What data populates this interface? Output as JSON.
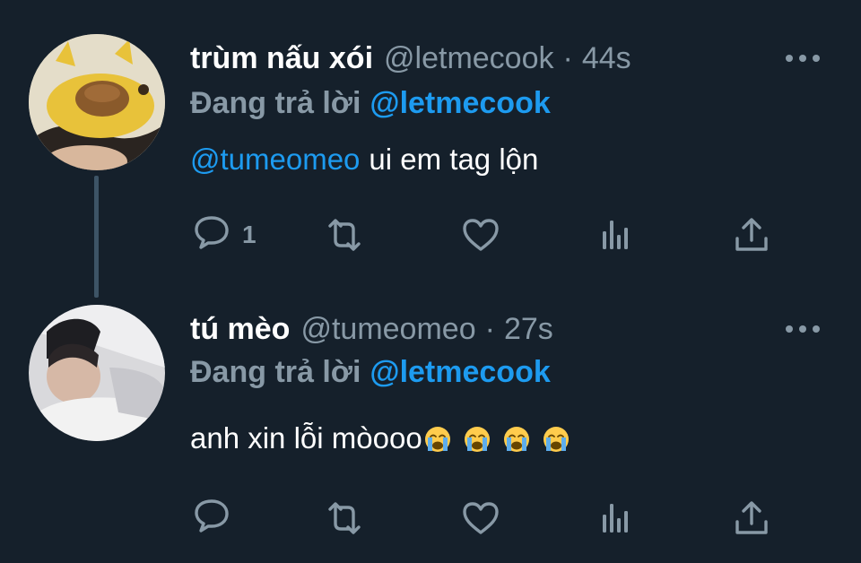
{
  "tweets": [
    {
      "display_name": "trùm nấu xói",
      "handle": "@letmecook",
      "separator": "·",
      "time": "44s",
      "reply_prefix": "Đang trả lời",
      "reply_to": "@letmecook",
      "mention": "@tumeomeo",
      "text": "ui em tag lộn",
      "reply_count": "1"
    },
    {
      "display_name": "tú mèo",
      "handle": "@tumeomeo",
      "separator": "·",
      "time": "27s",
      "reply_prefix": "Đang trả lời",
      "reply_to": "@letmecook",
      "text": "anh xin lỗi mòooo",
      "emojis": [
        "loudly-crying-face",
        "loudly-crying-face",
        "loudly-crying-face",
        "loudly-crying-face"
      ],
      "reply_count": ""
    }
  ],
  "icons": {
    "reply": "reply-icon",
    "retweet": "retweet-icon",
    "like": "heart-icon",
    "analytics": "analytics-icon",
    "share": "share-icon",
    "more": "more-icon"
  },
  "colors": {
    "background": "#15202b",
    "secondary_text": "#8899a6",
    "link": "#1d9bf0",
    "primary_text": "#ffffff",
    "thread_line": "#3d5466"
  }
}
